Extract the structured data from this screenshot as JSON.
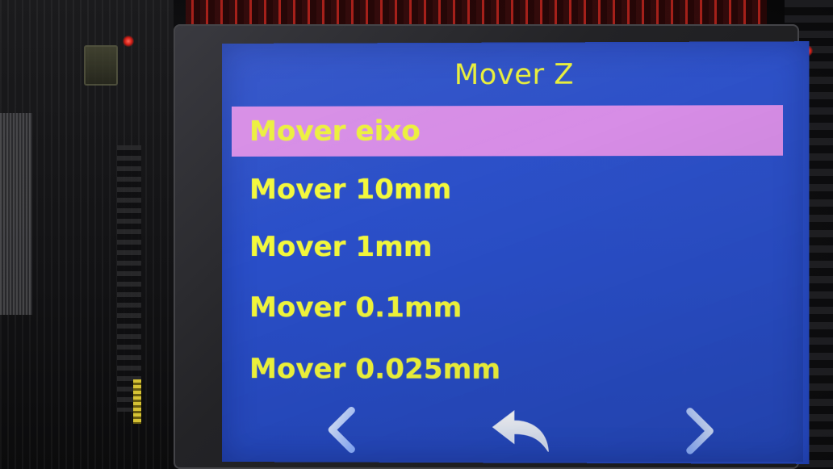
{
  "screen": {
    "title": "Mover Z",
    "menu_items": [
      {
        "label": "Mover eixo",
        "selected": true
      },
      {
        "label": "Mover 10mm",
        "selected": false
      },
      {
        "label": "Mover 1mm",
        "selected": false
      },
      {
        "label": "Mover 0.1mm",
        "selected": false
      },
      {
        "label": "Mover 0.025mm",
        "selected": false
      }
    ],
    "nav": {
      "prev_icon": "chevron-left-icon",
      "back_icon": "back-arrow-icon",
      "next_icon": "chevron-right-icon"
    }
  },
  "colors": {
    "screen_background": "#2a4fc9",
    "text": "#f3f83c",
    "selected_background": "#d78de6",
    "nav_icon": "#b9d4ff"
  }
}
